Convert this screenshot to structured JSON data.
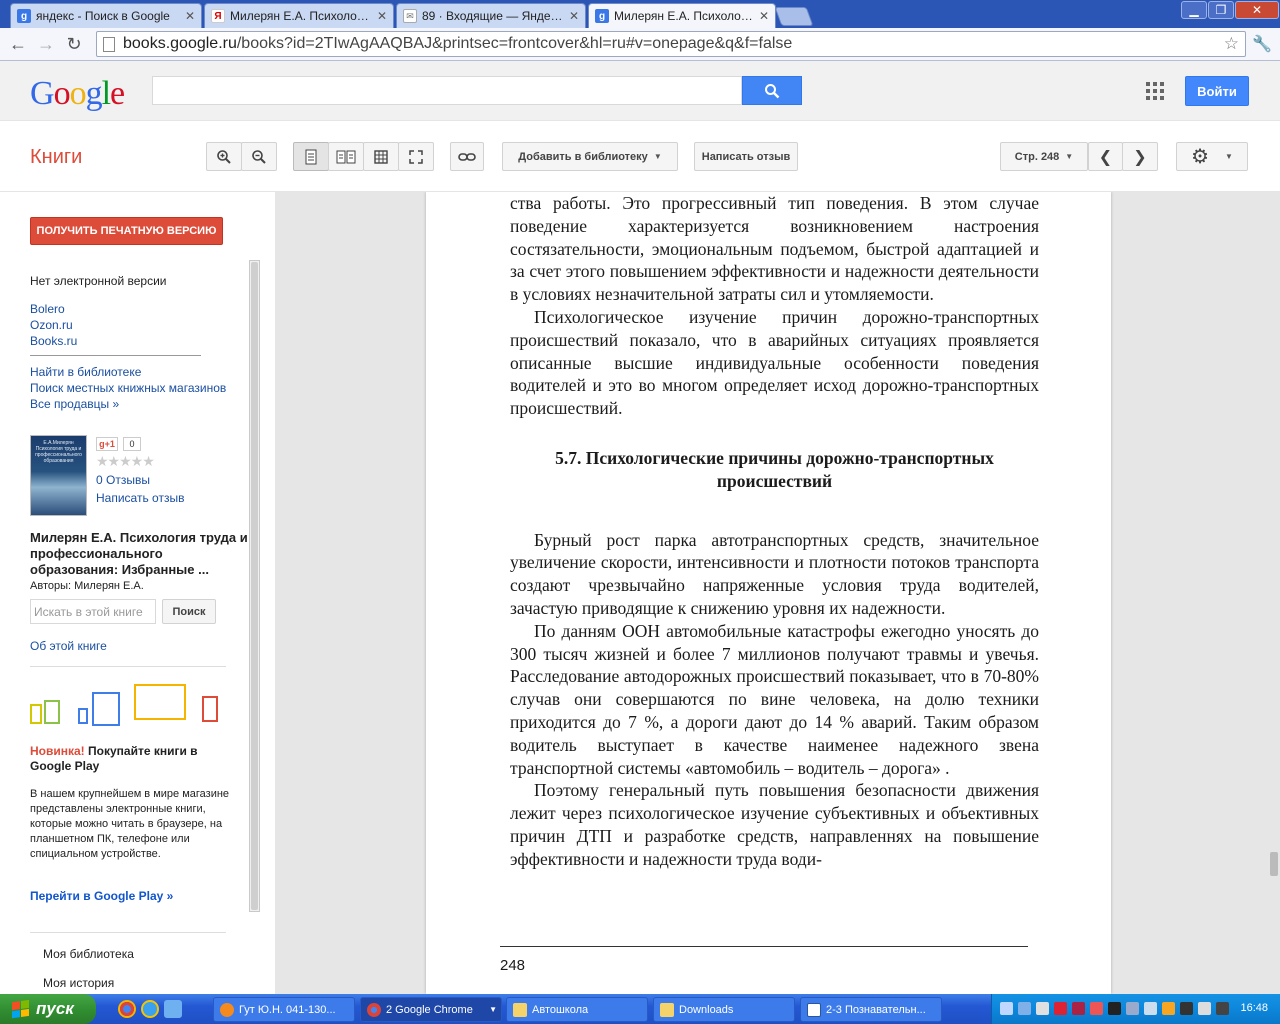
{
  "browser": {
    "tabs": [
      {
        "label": "яндекс - Поиск в Google",
        "favicon": "google-icon",
        "active": false
      },
      {
        "label": "Милерян Е.А. Психология т...",
        "favicon": "yandex-icon",
        "active": false
      },
      {
        "label": "89 · Входящие — Яндекс.П...",
        "favicon": "mail-icon",
        "active": false
      },
      {
        "label": "Милерян Е.А. Психология т...",
        "favicon": "google-icon",
        "active": true
      }
    ],
    "url_host": "books.google.ru",
    "url_path": "/books?id=2TIwAgAAQBAJ&printsec=frontcover&hl=ru#v=onepage&q&f=false"
  },
  "google_header": {
    "logo": "Google",
    "search_value": "",
    "signin_label": "Войти"
  },
  "books_toolbar": {
    "title": "Книги",
    "add_library_label": "Добавить в библиотеку",
    "write_review_label": "Написать отзыв",
    "page_label": "Стр. 248"
  },
  "left_panel": {
    "print_button": "ПОЛУЧИТЬ ПЕЧАТНУЮ ВЕРСИЮ",
    "no_ebook": "Нет электронной версии",
    "sellers": [
      "Bolero",
      "Ozon.ru",
      "Books.ru"
    ],
    "find_library": "Найти в библиотеке",
    "local_stores": "Поиск местных книжных магазинов",
    "all_sellers": "Все продавцы »",
    "gplus_label": "g+1",
    "gplus_count": "0",
    "stars": "★★★★★",
    "reviews": "0 Отзывы",
    "write_review": "Написать отзыв",
    "cover_text": "Е.А.Милерян Психология труда и профессионального образования",
    "book_title": "Милерян Е.А. Психология труда и профессионального образования: Избранные ...",
    "authors": "Авторы: Милерян Е.А.",
    "search_placeholder": "Искать в этой книге",
    "search_button": "Поиск",
    "about": "Об этой книге",
    "promo_new": "Новинка!",
    "promo_title": " Покупайте книги в Google Play",
    "promo_body": "В нашем крупнейшем в мире магазине представлены электронные книги, которые можно читать в браузере, на планшетном ПК, телефоне или спициальном устройстве.",
    "play_link": "Перейти в Google Play »",
    "my_library": "Моя библиотека",
    "my_history": "Моя история"
  },
  "page": {
    "p1": "ства работы. Это прогрессивный тип поведения. В этом случае поведение характеризуется возникновением настроения состязательности, эмоциональным подъемом, быстрой адаптацией и за счет этого повышением эффективности и надежности деятельности в условиях незначительной затраты сил и утомляемости.",
    "p2": "Психологическое изучение причин дорожно-транспортных происшествий показало, что в аварийных ситуациях проявляется описанные высшие индивидуальные особенности поведения водителей и это во многом определяет исход дорожно-транспортных происшествий.",
    "heading": "5.7. Психологические причины дорожно-транспортных происшествий",
    "p3": "Бурный рост парка автотранспортных средств, значительное увеличение скорости, интенсивности и плотности потоков транспорта создают чрезвычайно напряженные условия труда водителей, зачастую приводящие к снижению уровня их надежности.",
    "p4": "По данням ООН автомобильные катастрофы ежегодно уносять до 300 тысяч жизней и более 7 миллионов получают травмы и увечья. Расследование автодорожных происшествий показывает, что в 70-80% случав они совершаются по вине человека, на долю техники приходится до 7 %, а дороги дают до 14 % аварий. Таким образом водитель выступает в качестве наименее надежного звена транспортной системы «автомобиль – водитель – дорога» .",
    "p5": "Поэтому генеральный путь повышения безопасности движения лежит через психологическое изучение субъективных и объективных причин ДТП и разработке средств, направленнях на повышение эффективности и надежности труда води-",
    "page_number": "248"
  },
  "taskbar": {
    "start_label": "пуск",
    "buttons": [
      {
        "label": "Гут Ю.Н. 041-130...",
        "icon": "browser-icon"
      },
      {
        "label": "2 Google Chrome",
        "icon": "chrome-icon"
      },
      {
        "label": "Автошкола",
        "icon": "folder-icon"
      },
      {
        "label": "Downloads",
        "icon": "folder-icon"
      },
      {
        "label": "2-3 Познавательн...",
        "icon": "document-icon"
      }
    ],
    "clock": "16:48"
  }
}
